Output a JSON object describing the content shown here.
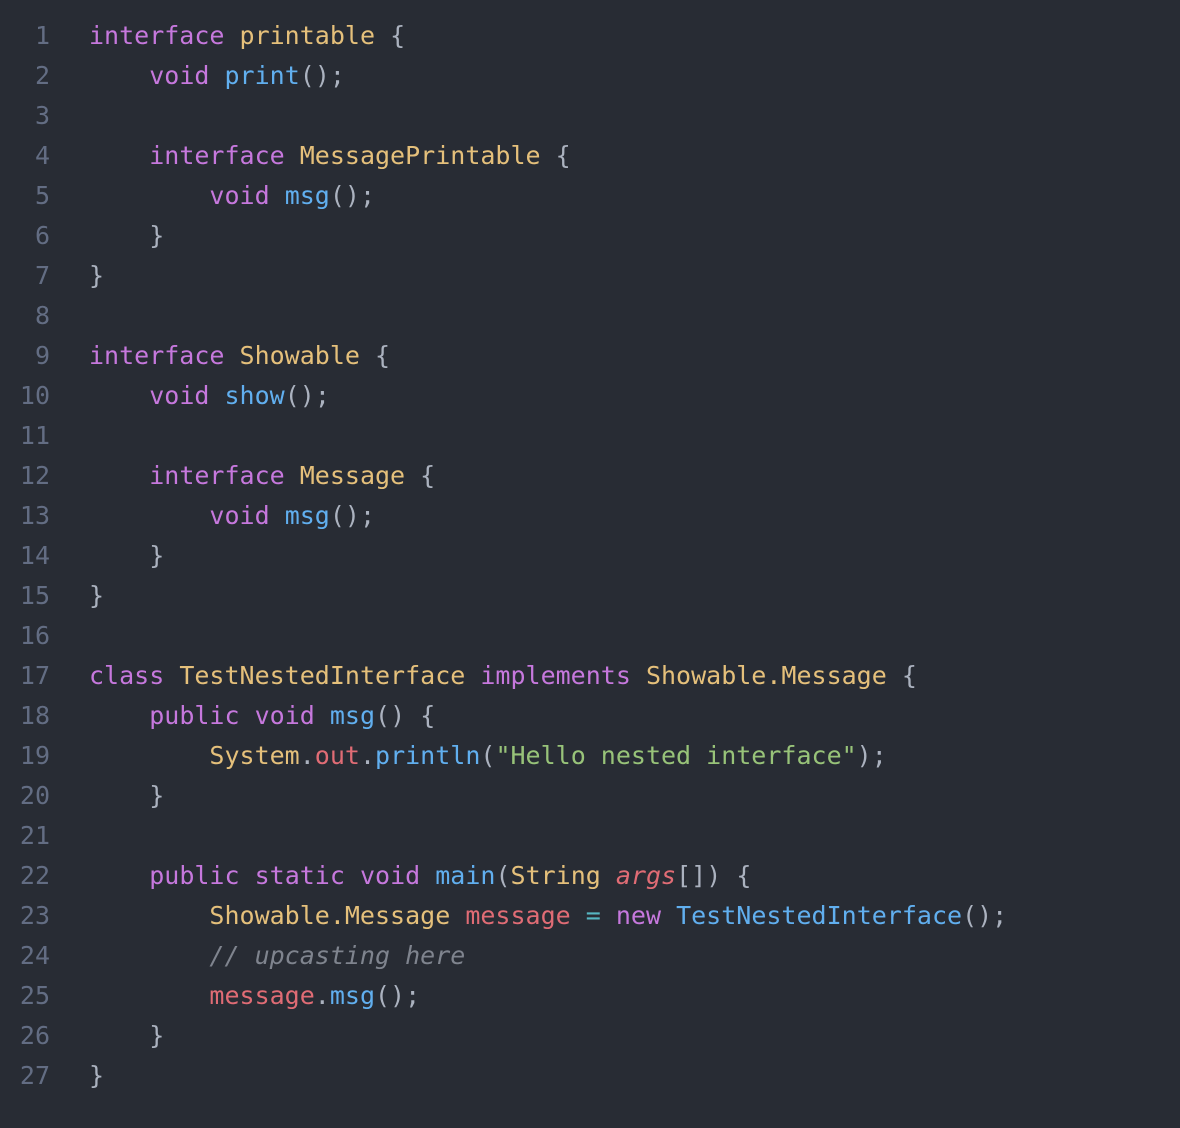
{
  "editor": {
    "language": "java",
    "theme": "one-dark",
    "background_color": "#282c34",
    "gutter_color": "#636d83",
    "total_lines": 27
  },
  "syntax_colors": {
    "keyword": "#c678dd",
    "type": "#e5c07b",
    "function": "#61afef",
    "class": "#61afef",
    "variable": "#e06c75",
    "string": "#98c379",
    "comment": "#7f848e",
    "operator": "#56b6c2",
    "punctuation": "#abb2bf"
  },
  "lines": [
    {
      "n": "1",
      "tokens": [
        {
          "t": "interface",
          "c": "keyword"
        },
        {
          "t": " ",
          "c": "plain"
        },
        {
          "t": "printable",
          "c": "type"
        },
        {
          "t": " ",
          "c": "plain"
        },
        {
          "t": "{",
          "c": "punct"
        }
      ]
    },
    {
      "n": "2",
      "tokens": [
        {
          "t": "    ",
          "c": "plain"
        },
        {
          "t": "void",
          "c": "keyword"
        },
        {
          "t": " ",
          "c": "plain"
        },
        {
          "t": "print",
          "c": "function"
        },
        {
          "t": "();",
          "c": "punct"
        }
      ]
    },
    {
      "n": "3",
      "tokens": []
    },
    {
      "n": "4",
      "tokens": [
        {
          "t": "    ",
          "c": "plain"
        },
        {
          "t": "interface",
          "c": "keyword"
        },
        {
          "t": " ",
          "c": "plain"
        },
        {
          "t": "MessagePrintable",
          "c": "type"
        },
        {
          "t": " ",
          "c": "plain"
        },
        {
          "t": "{",
          "c": "punct"
        }
      ]
    },
    {
      "n": "5",
      "tokens": [
        {
          "t": "        ",
          "c": "plain"
        },
        {
          "t": "void",
          "c": "keyword"
        },
        {
          "t": " ",
          "c": "plain"
        },
        {
          "t": "msg",
          "c": "function"
        },
        {
          "t": "();",
          "c": "punct"
        }
      ]
    },
    {
      "n": "6",
      "tokens": [
        {
          "t": "    ",
          "c": "plain"
        },
        {
          "t": "}",
          "c": "punct"
        }
      ]
    },
    {
      "n": "7",
      "tokens": [
        {
          "t": "}",
          "c": "punct"
        }
      ]
    },
    {
      "n": "8",
      "tokens": []
    },
    {
      "n": "9",
      "tokens": [
        {
          "t": "interface",
          "c": "keyword"
        },
        {
          "t": " ",
          "c": "plain"
        },
        {
          "t": "Showable",
          "c": "type"
        },
        {
          "t": " ",
          "c": "plain"
        },
        {
          "t": "{",
          "c": "punct"
        }
      ]
    },
    {
      "n": "10",
      "tokens": [
        {
          "t": "    ",
          "c": "plain"
        },
        {
          "t": "void",
          "c": "keyword"
        },
        {
          "t": " ",
          "c": "plain"
        },
        {
          "t": "show",
          "c": "function"
        },
        {
          "t": "();",
          "c": "punct"
        }
      ]
    },
    {
      "n": "11",
      "tokens": []
    },
    {
      "n": "12",
      "tokens": [
        {
          "t": "    ",
          "c": "plain"
        },
        {
          "t": "interface",
          "c": "keyword"
        },
        {
          "t": " ",
          "c": "plain"
        },
        {
          "t": "Message",
          "c": "type"
        },
        {
          "t": " ",
          "c": "plain"
        },
        {
          "t": "{",
          "c": "punct"
        }
      ]
    },
    {
      "n": "13",
      "tokens": [
        {
          "t": "        ",
          "c": "plain"
        },
        {
          "t": "void",
          "c": "keyword"
        },
        {
          "t": " ",
          "c": "plain"
        },
        {
          "t": "msg",
          "c": "function"
        },
        {
          "t": "();",
          "c": "punct"
        }
      ]
    },
    {
      "n": "14",
      "tokens": [
        {
          "t": "    ",
          "c": "plain"
        },
        {
          "t": "}",
          "c": "punct"
        }
      ]
    },
    {
      "n": "15",
      "tokens": [
        {
          "t": "}",
          "c": "punct"
        }
      ]
    },
    {
      "n": "16",
      "tokens": []
    },
    {
      "n": "17",
      "tokens": [
        {
          "t": "class",
          "c": "keyword"
        },
        {
          "t": " ",
          "c": "plain"
        },
        {
          "t": "TestNestedInterface",
          "c": "type"
        },
        {
          "t": " ",
          "c": "plain"
        },
        {
          "t": "implements",
          "c": "keyword"
        },
        {
          "t": " ",
          "c": "plain"
        },
        {
          "t": "Showable.Message",
          "c": "type"
        },
        {
          "t": " ",
          "c": "plain"
        },
        {
          "t": "{",
          "c": "punct"
        }
      ]
    },
    {
      "n": "18",
      "tokens": [
        {
          "t": "    ",
          "c": "plain"
        },
        {
          "t": "public",
          "c": "keyword"
        },
        {
          "t": " ",
          "c": "plain"
        },
        {
          "t": "void",
          "c": "keyword"
        },
        {
          "t": " ",
          "c": "plain"
        },
        {
          "t": "msg",
          "c": "function"
        },
        {
          "t": "()",
          "c": "punct"
        },
        {
          "t": " ",
          "c": "plain"
        },
        {
          "t": "{",
          "c": "punct"
        }
      ]
    },
    {
      "n": "19",
      "tokens": [
        {
          "t": "        ",
          "c": "plain"
        },
        {
          "t": "System",
          "c": "type"
        },
        {
          "t": ".",
          "c": "punct"
        },
        {
          "t": "out",
          "c": "variable"
        },
        {
          "t": ".",
          "c": "punct"
        },
        {
          "t": "println",
          "c": "function"
        },
        {
          "t": "(",
          "c": "punct"
        },
        {
          "t": "\"Hello nested interface\"",
          "c": "string"
        },
        {
          "t": ");",
          "c": "punct"
        }
      ]
    },
    {
      "n": "20",
      "tokens": [
        {
          "t": "    ",
          "c": "plain"
        },
        {
          "t": "}",
          "c": "punct"
        }
      ]
    },
    {
      "n": "21",
      "tokens": []
    },
    {
      "n": "22",
      "tokens": [
        {
          "t": "    ",
          "c": "plain"
        },
        {
          "t": "public",
          "c": "keyword"
        },
        {
          "t": " ",
          "c": "plain"
        },
        {
          "t": "static",
          "c": "keyword"
        },
        {
          "t": " ",
          "c": "plain"
        },
        {
          "t": "void",
          "c": "keyword"
        },
        {
          "t": " ",
          "c": "plain"
        },
        {
          "t": "main",
          "c": "function"
        },
        {
          "t": "(",
          "c": "punct"
        },
        {
          "t": "String",
          "c": "type"
        },
        {
          "t": " ",
          "c": "plain"
        },
        {
          "t": "args",
          "c": "variable-italic"
        },
        {
          "t": "[])",
          "c": "punct"
        },
        {
          "t": " ",
          "c": "plain"
        },
        {
          "t": "{",
          "c": "punct"
        }
      ]
    },
    {
      "n": "23",
      "tokens": [
        {
          "t": "        ",
          "c": "plain"
        },
        {
          "t": "Showable.Message",
          "c": "type"
        },
        {
          "t": " ",
          "c": "plain"
        },
        {
          "t": "message",
          "c": "variable"
        },
        {
          "t": " ",
          "c": "plain"
        },
        {
          "t": "=",
          "c": "operator"
        },
        {
          "t": " ",
          "c": "plain"
        },
        {
          "t": "new",
          "c": "keyword"
        },
        {
          "t": " ",
          "c": "plain"
        },
        {
          "t": "TestNestedInterface",
          "c": "class"
        },
        {
          "t": "();",
          "c": "punct"
        }
      ]
    },
    {
      "n": "24",
      "tokens": [
        {
          "t": "        ",
          "c": "plain"
        },
        {
          "t": "// upcasting here",
          "c": "comment"
        }
      ]
    },
    {
      "n": "25",
      "tokens": [
        {
          "t": "        ",
          "c": "plain"
        },
        {
          "t": "message",
          "c": "variable"
        },
        {
          "t": ".",
          "c": "punct"
        },
        {
          "t": "msg",
          "c": "function"
        },
        {
          "t": "();",
          "c": "punct"
        }
      ]
    },
    {
      "n": "26",
      "tokens": [
        {
          "t": "    ",
          "c": "plain"
        },
        {
          "t": "}",
          "c": "punct"
        }
      ]
    },
    {
      "n": "27",
      "tokens": [
        {
          "t": "}",
          "c": "punct"
        }
      ]
    }
  ]
}
